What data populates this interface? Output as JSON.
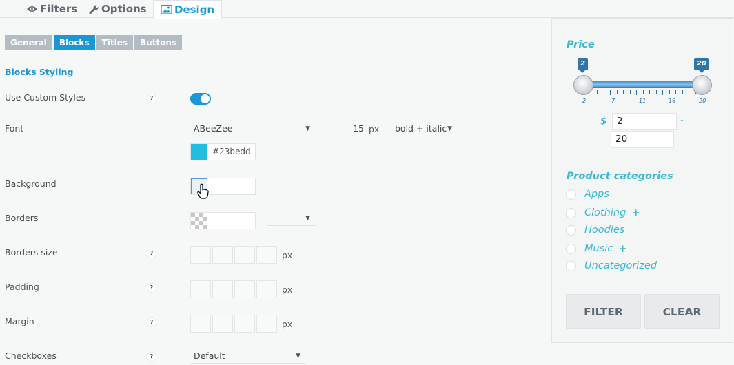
{
  "tabs": [
    {
      "label": "Filters",
      "icon": "eye-icon"
    },
    {
      "label": "Options",
      "icon": "wrench-icon"
    },
    {
      "label": "Design",
      "icon": "image-icon",
      "active": true
    }
  ],
  "subtabs": [
    {
      "label": "General"
    },
    {
      "label": "Blocks",
      "active": true
    },
    {
      "label": "Titles"
    },
    {
      "label": "Buttons"
    }
  ],
  "section_title": "Blocks Styling",
  "rows": {
    "custom_styles": {
      "label": "Use Custom Styles",
      "help": "?",
      "enabled": true
    },
    "font": {
      "label": "Font",
      "family": "ABeeZee",
      "size": "15",
      "unit": "px",
      "style": "bold + italic",
      "color_hex": "#23bedd",
      "color_swatch": "#23bedd"
    },
    "background": {
      "label": "Background"
    },
    "borders": {
      "label": "Borders"
    },
    "borders_size": {
      "label": "Borders size",
      "help": "?",
      "unit": "px"
    },
    "padding": {
      "label": "Padding",
      "help": "?",
      "unit": "px"
    },
    "margin": {
      "label": "Margin",
      "help": "?",
      "unit": "px"
    },
    "checkboxes": {
      "label": "Checkboxes",
      "help": "?",
      "value": "Default"
    }
  },
  "preview": {
    "price_title": "Price",
    "slider_min_badge": "2",
    "slider_max_badge": "20",
    "tick_labels": [
      "2",
      "7",
      "11",
      "16",
      "20"
    ],
    "currency": "$",
    "range_dash": "-",
    "min_value": "2",
    "max_value": "20",
    "categories_title": "Product categories",
    "categories": [
      {
        "label": "Apps",
        "plus": ""
      },
      {
        "label": "Clothing",
        "plus": "+"
      },
      {
        "label": "Hoodies",
        "plus": ""
      },
      {
        "label": "Music",
        "plus": "+"
      },
      {
        "label": "Uncategorized",
        "plus": ""
      }
    ],
    "filter_button": "FILTER",
    "clear_button": "CLEAR"
  },
  "colors": {
    "accent": "#1a97d4",
    "preview_accent": "#3bb7d3",
    "slider": "#2f75a9"
  }
}
